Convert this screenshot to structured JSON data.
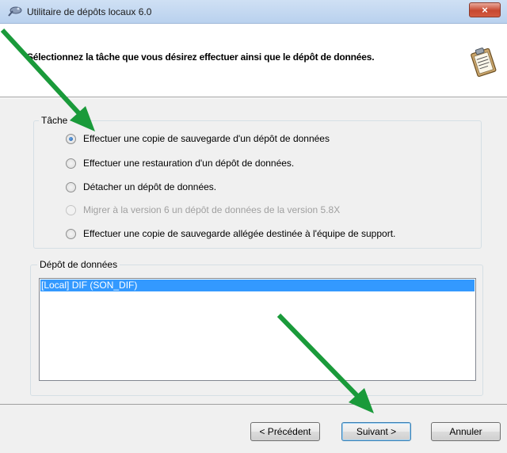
{
  "window": {
    "title": "Utilitaire de dépôts locaux 6.0",
    "close_label": "×",
    "icon": "satellite-dish-icon"
  },
  "header": {
    "instruction": "Sélectionnez la tâche que vous désirez effectuer ainsi que le dépôt de données.",
    "icon": "clipboard-icon"
  },
  "task_group": {
    "legend": "Tâche",
    "options": [
      {
        "label": "Effectuer une copie de sauvegarde d'un dépôt de données",
        "checked": true,
        "enabled": true
      },
      {
        "label": "Effectuer une restauration d'un dépôt de données.",
        "checked": false,
        "enabled": true
      },
      {
        "label": "Détacher un dépôt de données.",
        "checked": false,
        "enabled": true
      },
      {
        "label": "Migrer à la version 6 un dépôt de données de la version 5.8X",
        "checked": false,
        "enabled": false
      },
      {
        "label": "Effectuer une copie de sauvegarde allégée destinée à l'équipe de support.",
        "checked": false,
        "enabled": true
      }
    ]
  },
  "store_group": {
    "legend": "Dépôt de données",
    "items": [
      {
        "label": "[Local] DIF (SON_DIF)",
        "selected": true
      }
    ]
  },
  "footer": {
    "prev_label": "< Précédent",
    "next_label": "Suivant >",
    "cancel_label": "Annuler"
  },
  "colors": {
    "selection": "#3399ff",
    "arrow": "#1a9a3a",
    "close_button": "#c7472f"
  }
}
